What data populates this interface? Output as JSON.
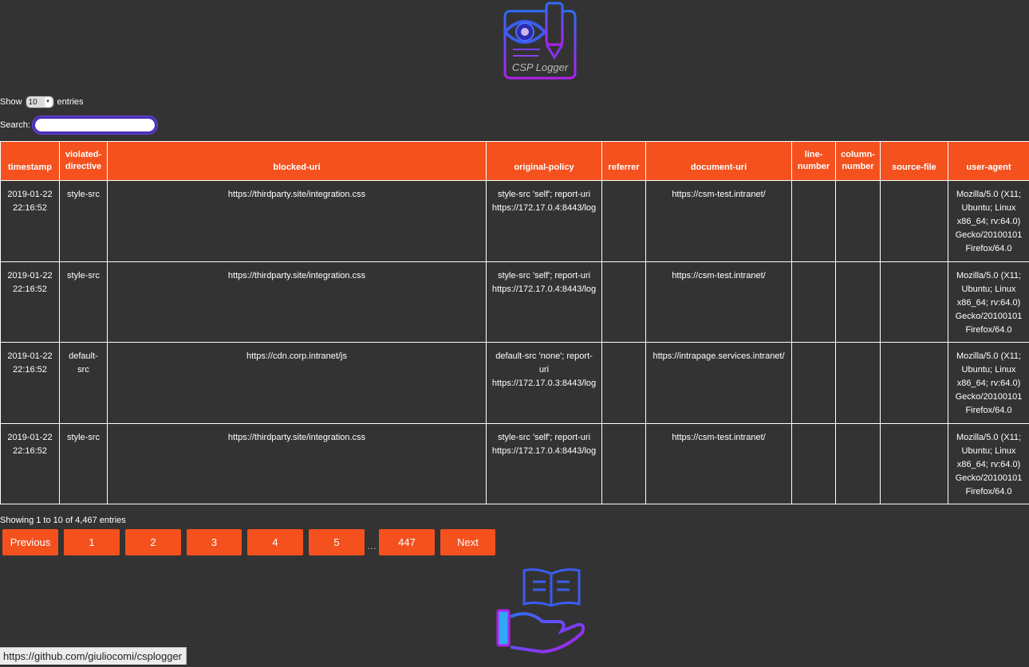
{
  "logo": {
    "text": "CSP Logger"
  },
  "controls": {
    "show_label": "Show",
    "entries_value": "10",
    "entries_label": "entries",
    "search_label": "Search:",
    "search_value": ""
  },
  "table": {
    "headers": [
      "timestamp",
      "violated-directive",
      "blocked-uri",
      "original-policy",
      "referrer",
      "document-uri",
      "line-number",
      "column-number",
      "source-file",
      "user-agent"
    ],
    "rows": [
      {
        "timestamp": "2019-01-22 22:16:52",
        "violated_directive": "style-src",
        "blocked_uri": "https://thirdparty.site/integration.css",
        "original_policy": "style-src 'self'; report-uri https://172.17.0.4:8443/log",
        "referrer": "",
        "document_uri": "https://csm-test.intranet/",
        "line_number": "",
        "column_number": "",
        "source_file": "",
        "user_agent": "Mozilla/5.0 (X11; Ubuntu; Linux x86_64; rv:64.0) Gecko/20100101 Firefox/64.0"
      },
      {
        "timestamp": "2019-01-22 22:16:52",
        "violated_directive": "style-src",
        "blocked_uri": "https://thirdparty.site/integration.css",
        "original_policy": "style-src 'self'; report-uri https://172.17.0.4:8443/log",
        "referrer": "",
        "document_uri": "https://csm-test.intranet/",
        "line_number": "",
        "column_number": "",
        "source_file": "",
        "user_agent": "Mozilla/5.0 (X11; Ubuntu; Linux x86_64; rv:64.0) Gecko/20100101 Firefox/64.0"
      },
      {
        "timestamp": "2019-01-22 22:16:52",
        "violated_directive": "default-src",
        "blocked_uri": "https://cdn.corp.intranet/js",
        "original_policy": "default-src 'none'; report-uri https://172.17.0.3:8443/log",
        "referrer": "",
        "document_uri": "https://intrapage.services.intranet/",
        "line_number": "",
        "column_number": "",
        "source_file": "",
        "user_agent": "Mozilla/5.0 (X11; Ubuntu; Linux x86_64; rv:64.0) Gecko/20100101 Firefox/64.0"
      },
      {
        "timestamp": "2019-01-22 22:16:52",
        "violated_directive": "style-src",
        "blocked_uri": "https://thirdparty.site/integration.css",
        "original_policy": "style-src 'self'; report-uri https://172.17.0.4:8443/log",
        "referrer": "",
        "document_uri": "https://csm-test.intranet/",
        "line_number": "",
        "column_number": "",
        "source_file": "",
        "user_agent": "Mozilla/5.0 (X11; Ubuntu; Linux x86_64; rv:64.0) Gecko/20100101 Firefox/64.0"
      }
    ]
  },
  "pagination": {
    "info": "Showing 1 to 10 of 4,467 entries",
    "previous": "Previous",
    "pages": [
      "1",
      "2",
      "3",
      "4",
      "5"
    ],
    "ellipsis": "…",
    "last_page": "447",
    "next": "Next"
  },
  "status_bar": {
    "url": "https://github.com/giuliocomi/csplogger"
  },
  "colors": {
    "accent": "#f4511e",
    "background": "#333333",
    "icon_blue": "#2f6cf5",
    "icon_purple": "#a020f0"
  }
}
